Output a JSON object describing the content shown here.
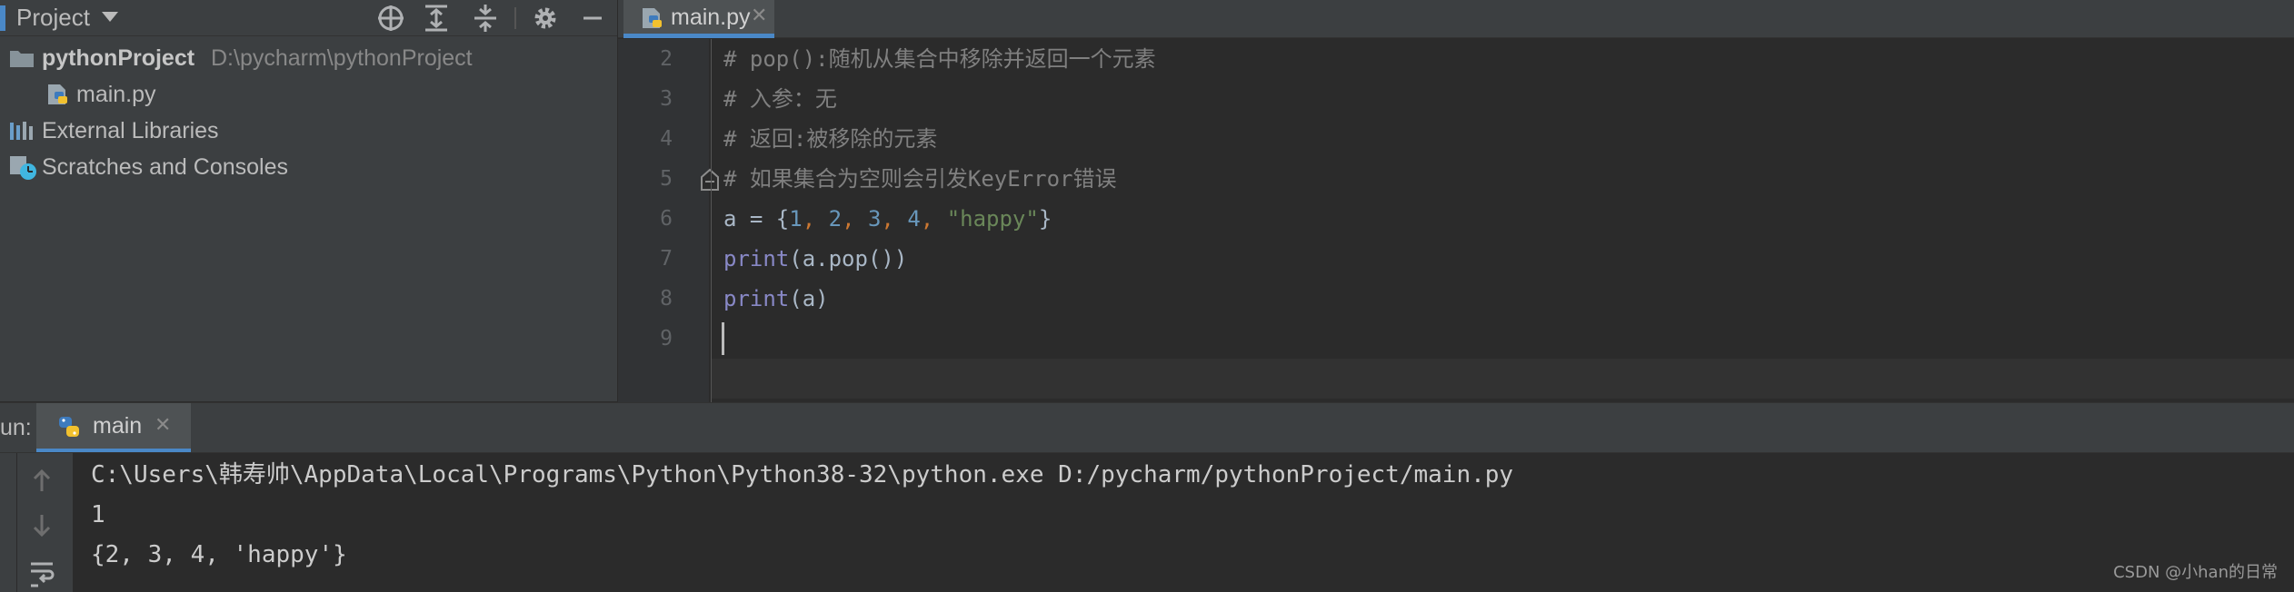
{
  "project_panel": {
    "title": "Project",
    "tree": [
      {
        "label": "pythonProject",
        "path": "D:\\pycharm\\pythonProject"
      },
      {
        "label": "main.py"
      },
      {
        "label": "External Libraries"
      },
      {
        "label": "Scratches and Consoles"
      }
    ]
  },
  "editor": {
    "tab": {
      "label": "main.py"
    },
    "lines": [
      {
        "num": "2",
        "comment": "# pop():随机从集合中移除并返回一个元素"
      },
      {
        "num": "3",
        "comment": "# 入参：无"
      },
      {
        "num": "4",
        "comment": "# 返回:被移除的元素"
      },
      {
        "num": "5",
        "comment": "# 如果集合为空则会引发KeyError错误"
      },
      {
        "num": "6"
      },
      {
        "num": "7"
      },
      {
        "num": "8"
      },
      {
        "num": "9"
      }
    ],
    "code6": {
      "var": "a = {",
      "n1": "1",
      "n2": "2",
      "n3": "3",
      "n4": "4",
      "s": "\"happy\"",
      "close": "}",
      "comma": ", "
    },
    "code7": {
      "fn": "print",
      "args": "(a.pop())"
    },
    "code8": {
      "fn": "print",
      "args": "(a)"
    }
  },
  "run": {
    "label": "un:",
    "tab_label": "main",
    "output": [
      "C:\\Users\\韩寿帅\\AppData\\Local\\Programs\\Python\\Python38-32\\python.exe D:/pycharm/pythonProject/main.py",
      "1",
      "{2, 3, 4, 'happy'}"
    ]
  },
  "watermark": "CSDN @小han的日常"
}
